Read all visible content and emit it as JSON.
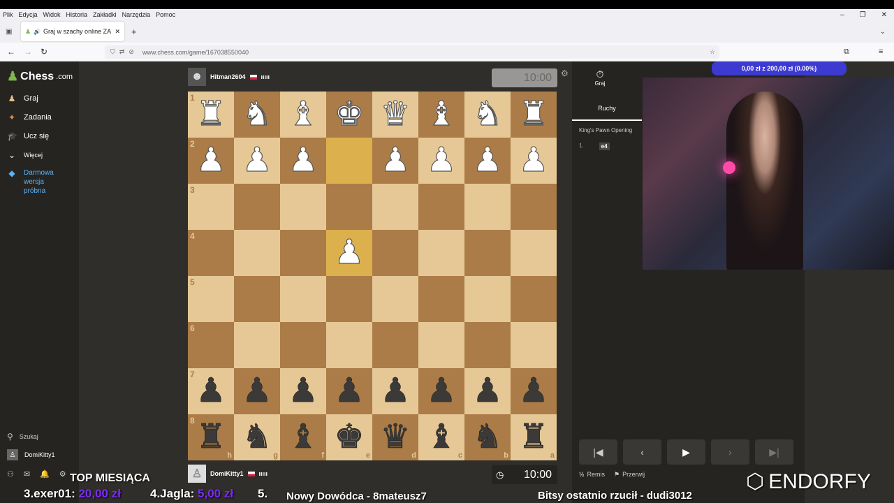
{
  "browser": {
    "menu": [
      "Plik",
      "Edycja",
      "Widok",
      "Historia",
      "Zakładki",
      "Narzędzia",
      "Pomoc"
    ],
    "tab_title": "Graj w szachy online ZA DARMO",
    "url": "www.chess.com/game/167038550040",
    "new_tab": "+",
    "close_tab": "✕"
  },
  "sidebar": {
    "logo_main": "Chess",
    "logo_suffix": ".com",
    "nav": [
      {
        "label": "Graj",
        "icon": "play-icon"
      },
      {
        "label": "Zadania",
        "icon": "puzzle-icon"
      },
      {
        "label": "Ucz się",
        "icon": "learn-icon"
      },
      {
        "label": "Więcej",
        "icon": "chevron-down-icon"
      }
    ],
    "trial_label": "Darmowa wersja próbna",
    "search_label": "Szukaj",
    "user_label": "DomiKitty1"
  },
  "game": {
    "top_player": "Hitman2604",
    "top_clock": "10:00",
    "bottom_player": "DomiKitty1",
    "bottom_clock": "10:00",
    "ranks": [
      "1",
      "2",
      "3",
      "4",
      "5",
      "6",
      "7",
      "8"
    ],
    "files": [
      "h",
      "g",
      "f",
      "e",
      "d",
      "c",
      "b",
      "a"
    ],
    "board": [
      [
        "wR",
        "wN",
        "wB",
        "wK",
        "wQ",
        "wB",
        "wN",
        "wR"
      ],
      [
        "wP",
        "wP",
        "wP",
        "",
        "wP",
        "wP",
        "wP",
        "wP"
      ],
      [
        "",
        "",
        "",
        "",
        "",
        "",
        "",
        ""
      ],
      [
        "",
        "",
        "",
        "wP",
        "",
        "",
        "",
        ""
      ],
      [
        "",
        "",
        "",
        "",
        "",
        "",
        "",
        ""
      ],
      [
        "",
        "",
        "",
        "",
        "",
        "",
        "",
        ""
      ],
      [
        "bP",
        "bP",
        "bP",
        "bP",
        "bP",
        "bP",
        "bP",
        "bP"
      ],
      [
        "bR",
        "bN",
        "bB",
        "bK",
        "bQ",
        "bB",
        "bN",
        "bR"
      ]
    ]
  },
  "panel": {
    "tab_play": "Graj",
    "tab_moves": "Ruchy",
    "opening": "King's Pawn Opening",
    "move_number": "1.",
    "move": "e4",
    "draw_label": "Remis",
    "abort_label": "Przerwij"
  },
  "stream": {
    "donation_goal": "0,00 zł z 200,00 zł (0.00%)",
    "top_title": "TOP MIESIĄCA",
    "top3_name": "3.exer01:",
    "top3_amount": "20,00 zł",
    "top4_name": "4.Jagla:",
    "top4_amount": "5,00 zł",
    "top5": "5.",
    "commander": "Nowy Dowódca - 8mateusz7",
    "bits": "Bitsy ostatnio rzucił - dudi3012",
    "sponsor": "ENDORFY",
    "colors": {
      "accent": "#81b64c",
      "donation_bar": "#3d3ad1",
      "amount": "#7b2cf5"
    }
  }
}
